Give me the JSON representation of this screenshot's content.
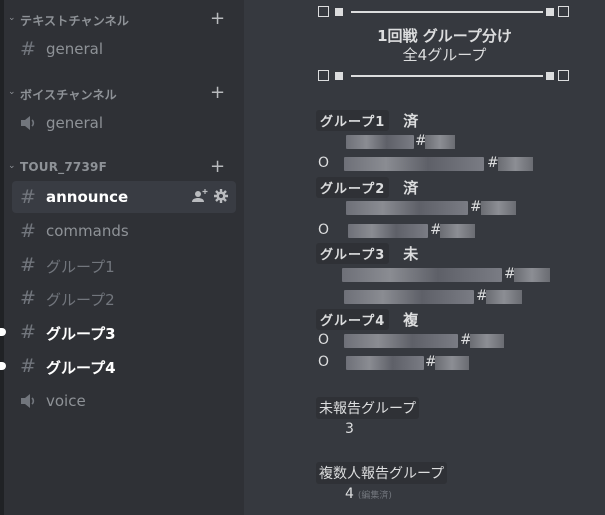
{
  "sidebar": {
    "categories": [
      {
        "label": "テキストチャンネル",
        "add_icon": "plus-icon"
      },
      {
        "label": "ボイスチャンネル",
        "add_icon": "plus-icon"
      },
      {
        "label": "TOUR_7739F",
        "add_icon": "plus-icon"
      }
    ],
    "text_general": {
      "label": "general",
      "icon": "hash-icon"
    },
    "voice_general": {
      "label": "general",
      "icon": "speaker-icon"
    },
    "tour_channels": [
      {
        "label": "announce",
        "icon": "hash-icon",
        "state": "selected"
      },
      {
        "label": "commands",
        "icon": "hash-icon",
        "state": "normal"
      },
      {
        "label": "グループ1",
        "icon": "hash-icon",
        "state": "muted"
      },
      {
        "label": "グループ2",
        "icon": "hash-icon",
        "state": "muted"
      },
      {
        "label": "グループ3",
        "icon": "hash-icon",
        "state": "unread"
      },
      {
        "label": "グループ4",
        "icon": "hash-icon",
        "state": "unread"
      },
      {
        "label": "voice",
        "icon": "speaker-icon",
        "state": "normal"
      }
    ],
    "selected_channel_icons": [
      "add-member-icon",
      "gear-icon"
    ]
  },
  "message": {
    "title": "1回戦 グループ分け",
    "subtitle": "全4グループ",
    "groups": [
      {
        "code": "グループ1",
        "status": "済",
        "members": [
          {
            "mark": "",
            "name": "[blurred]",
            "hash": "#",
            "tag": "[blurred]"
          },
          {
            "mark": "O",
            "name": "[blurred]",
            "hash": "#",
            "tag": "[blurred]"
          }
        ]
      },
      {
        "code": "グループ2",
        "status": "済",
        "members": [
          {
            "mark": "",
            "name": "[blurred]",
            "hash": "#",
            "tag": "[blurred]"
          },
          {
            "mark": "O",
            "name": "[blurred]",
            "hash": "#",
            "tag": "[blurred]"
          }
        ]
      },
      {
        "code": "グループ3",
        "status": "未",
        "members": [
          {
            "mark": "",
            "name": "[blurred]",
            "hash": "#",
            "tag": "[blurred]"
          },
          {
            "mark": "",
            "name": "[blurred]",
            "hash": "#",
            "tag": "[blurred]"
          }
        ]
      },
      {
        "code": "グループ4",
        "status": "複",
        "members": [
          {
            "mark": "O",
            "name": "[blurred]",
            "hash": "#",
            "tag": "[blurred]"
          },
          {
            "mark": "O",
            "name": "[blurred]",
            "hash": "#",
            "tag": "[blurred]"
          }
        ]
      }
    ],
    "unreported": {
      "label": "未報告グループ",
      "value": "3"
    },
    "multi_reported": {
      "label": "複数人報告グループ",
      "value": "4",
      "edited": "(編集済)"
    }
  },
  "colors": {
    "sidebar_bg": "#2f3136",
    "main_bg": "#36393f",
    "selected_bg": "#393c43",
    "text": "#dcddde",
    "muted": "#72767d"
  }
}
